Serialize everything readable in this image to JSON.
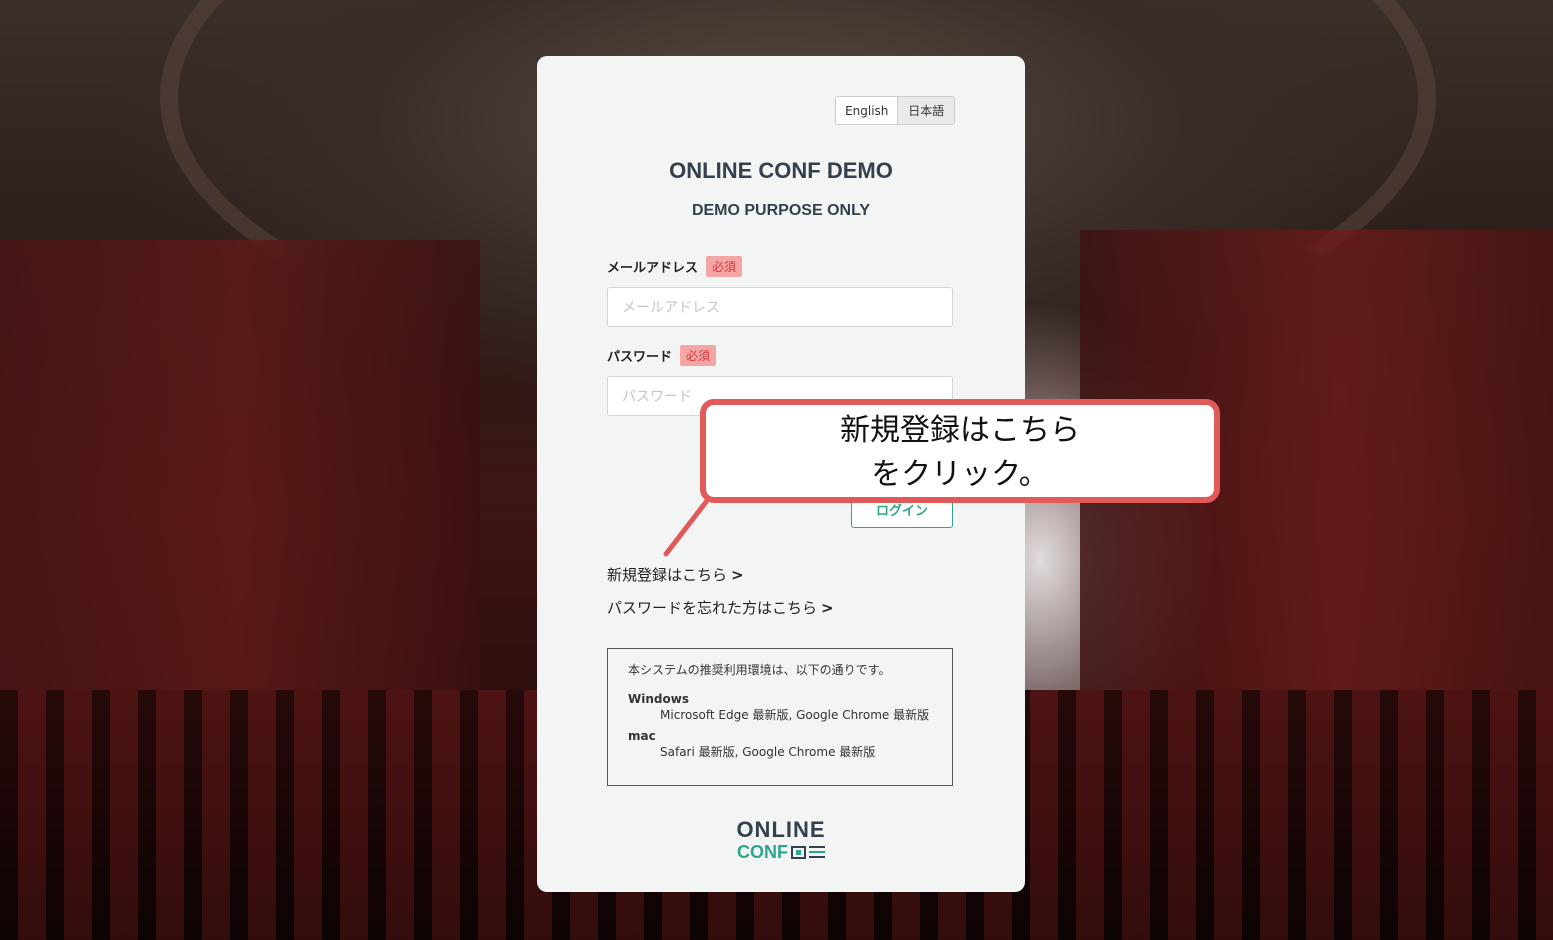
{
  "lang_switch": {
    "english": "English",
    "japanese": "日本語"
  },
  "card": {
    "title": "ONLINE CONF DEMO",
    "subtitle": "DEMO PURPOSE ONLY",
    "email": {
      "label": "メールアドレス",
      "required": "必須",
      "placeholder": "メールアドレス"
    },
    "password": {
      "label": "パスワード",
      "required": "必須",
      "placeholder": "パスワード"
    },
    "login_button": "ログイン",
    "register_link": "新規登録はこちら",
    "forgot_link": "パスワードを忘れた方はこちら",
    "chevron": ">",
    "environment": {
      "heading": "本システムの推奨利用環境は、以下の通りです。",
      "windows_label": "Windows",
      "windows_browsers": "Microsoft Edge 最新版, Google Chrome 最新版",
      "mac_label": "mac",
      "mac_browsers": "Safari 最新版, Google Chrome 最新版"
    },
    "logo": {
      "line1": "ONLINE",
      "line2": "CONF"
    }
  },
  "callout": {
    "line1": "新規登録はこちら",
    "line2": "をクリック。",
    "border_color": "#e25959"
  },
  "colors": {
    "accent": "#2fa58a",
    "required_bg": "#f4a6a6",
    "title": "#34404b"
  }
}
